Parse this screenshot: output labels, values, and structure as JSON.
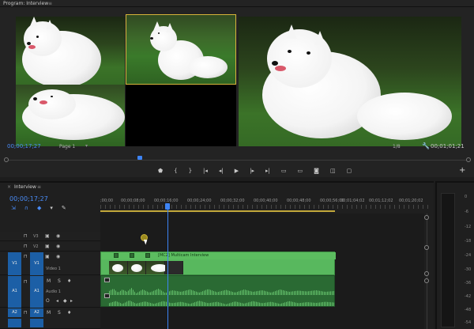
{
  "program": {
    "title": "Program: Interview",
    "menu_icon": "≡",
    "timecode_left": "00;00;17;27",
    "page_label": "Page 1",
    "page_arrow": "▾",
    "zoom": "1/8",
    "timecode_right": "00;01;01;21"
  },
  "transport": {
    "marker_icon": "marker-icon",
    "in_point": "{",
    "out_point": "}",
    "go_in": "|◂",
    "step_back": "◂|",
    "play": "▶",
    "step_fwd": "|▸",
    "go_out": "▸|",
    "lift": "▭",
    "extract": "▭",
    "camera_icon": "◙",
    "compare": "◫",
    "safe": "▢",
    "add": "+"
  },
  "timeline": {
    "close": "×",
    "title": "Interview",
    "menu_icon": "≡",
    "timecode": "00;00;17;27",
    "tools": [
      "⇲",
      "∩",
      "◆",
      "▾",
      "✎"
    ],
    "ruler_labels": [
      ";00;00",
      "00;00;08;00",
      "00;00;16;00",
      "00;00;24;00",
      "00;00;32;00",
      "00;00;40;00",
      "00;00;48;00",
      "00;00;56;00",
      "00;01;04;02",
      "00;01;12;02",
      "00;01;20;02"
    ],
    "tracks": {
      "v3": "V3",
      "v2": "V2",
      "v1": "V1",
      "v1_src": "V1",
      "video1_name": "Video 1",
      "a1": "A1",
      "a1_src": "A1",
      "audio1_name": "Audio 1",
      "a2": "A2",
      "a2_src": "A2",
      "m": "M",
      "s": "S",
      "lock": "🔒",
      "eye": "◉",
      "film": "▣",
      "mic": "🎙",
      "o_label": "O"
    },
    "clip_label": "[MC2] Multicam Interview",
    "clip_fx": "fx"
  },
  "meter": {
    "labels": [
      "0",
      "-6",
      "-12",
      "-18",
      "-24",
      "-30",
      "-36",
      "-42",
      "-48",
      "-54"
    ]
  }
}
